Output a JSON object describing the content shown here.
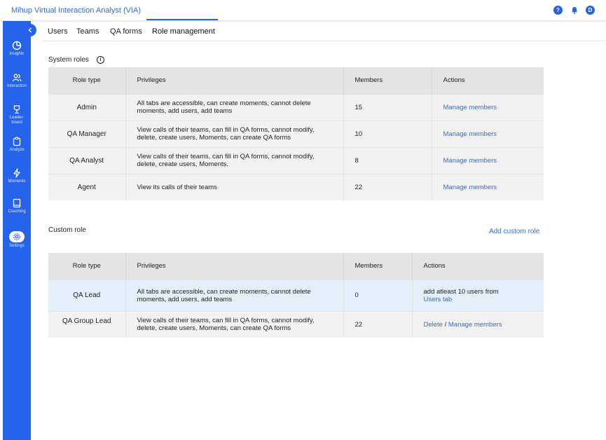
{
  "app": {
    "title": "Mihup Virtual Interaction Analyst (VIA)",
    "help_icon": "question-icon",
    "help_glyph": "?",
    "avatar_initial": "D"
  },
  "sidebar": {
    "items": [
      {
        "label": "Insights",
        "icon": "pie-chart-icon"
      },
      {
        "label": "Interaction",
        "icon": "users-icon"
      },
      {
        "label": "Leader-\nboard",
        "icon": "trophy-icon"
      },
      {
        "label": "Analyze",
        "icon": "clipboard-icon"
      },
      {
        "label": "Moments",
        "icon": "lightning-icon"
      },
      {
        "label": "Coaching",
        "icon": "book-icon"
      },
      {
        "label": "Settings",
        "icon": "gear-icon",
        "active": true
      }
    ]
  },
  "tabs": [
    {
      "label": "Users"
    },
    {
      "label": "Teams"
    },
    {
      "label": "QA forms"
    },
    {
      "label": "Role management",
      "active": true
    }
  ],
  "system_roles": {
    "title": "System roles",
    "info_glyph": "i",
    "headers": [
      "Role type",
      "Privileges",
      "Members",
      "Actions"
    ],
    "rows": [
      {
        "role": "Admin",
        "privileges": "All tabs are accessible, can create moments, cannot delete moments, add users, add teams",
        "members": "15",
        "action": "Manage members"
      },
      {
        "role": "QA Manager",
        "privileges": "View calls of their teams, can fill in QA forms, cannot modify, delete, create users, Moments, can create QA forms",
        "members": "10",
        "action": "Manage members"
      },
      {
        "role": "QA Analyst",
        "privileges": "View calls of their teams, can fill in QA forms, cannot modify, delete, create users, Moments.",
        "members": "8",
        "action": "Manage members"
      },
      {
        "role": "Agent",
        "privileges": "View its calls of their teams",
        "members": "22",
        "action": "Manage members"
      }
    ]
  },
  "custom_roles": {
    "title": "Custom role",
    "add_label": "Add custom role",
    "headers": [
      "Role type",
      "Privileges",
      "Members",
      "Actions"
    ],
    "rows": [
      {
        "role": "QA Lead",
        "privileges": "All tabs are accessible, can create moments, cannot delete moments, add users, add teams",
        "members": "0",
        "action_text": "add atleast 10 users from",
        "action_link": "Users tab"
      },
      {
        "role": "QA Group Lead",
        "privileges": "View calls of their teams, can fill in QA forms, cannot modify, delete, create users, Moments, can create QA forms",
        "members": "22",
        "action_delete": "Delete",
        "action_sep": " / ",
        "action_manage": "Manage members"
      }
    ]
  },
  "colors": {
    "accent": "#2563eb",
    "link": "#2f6bdc",
    "header_bg": "#e4e4e4",
    "row_bg": "#f2f2f2",
    "highlight_bg": "#e3f0fc"
  }
}
